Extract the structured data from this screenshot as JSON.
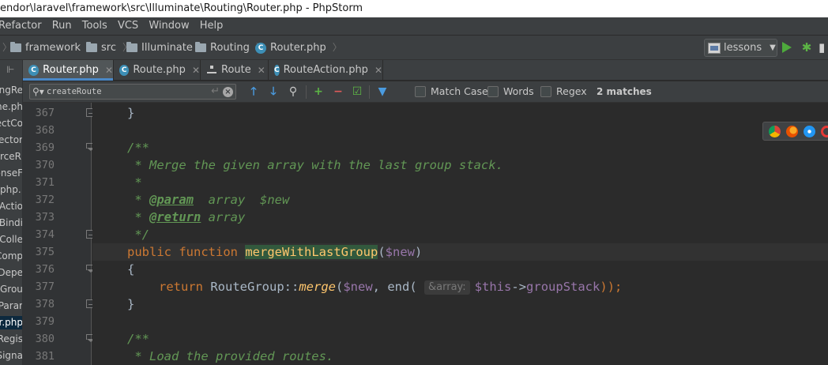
{
  "window": {
    "title": "endor\\laravel\\framework\\src\\Illuminate\\Routing\\Router.php - PhpStorm"
  },
  "menu": [
    "Refactor",
    "Run",
    "Tools",
    "VCS",
    "Window",
    "Help"
  ],
  "breadcrumbs": [
    "framework",
    "src",
    "Illuminate",
    "Routing",
    "Router.php"
  ],
  "run_config": {
    "label": "lessons"
  },
  "project_tree": [
    "ngRe",
    "ne.ph",
    "ectCo",
    "ector.",
    "rceR",
    "onseF",
    ".php",
    "Actio",
    "Bindi",
    "Colle",
    "Comp",
    "Depe",
    "Grou",
    "Parar",
    "r.php",
    "Regis",
    "Signa"
  ],
  "tabs": [
    {
      "label": "Router.php",
      "icon": "php-class-icon",
      "active": true
    },
    {
      "label": "Route.php",
      "icon": "php-class-icon",
      "active": false
    },
    {
      "label": "Route",
      "icon": "structure-icon",
      "active": false
    },
    {
      "label": "RouteAction.php",
      "icon": "php-class-icon",
      "active": false
    }
  ],
  "search": {
    "query": "createRoute",
    "match_case_label": "Match Case",
    "words_label": "Words",
    "regex_label": "Regex",
    "matches": "2 matches"
  },
  "editor": {
    "line_numbers": [
      "367",
      "368",
      "369",
      "370",
      "371",
      "372",
      "373",
      "374",
      "375",
      "376",
      "377",
      "378",
      "379",
      "380",
      "381"
    ],
    "code": {
      "l367": "}",
      "l369": "/**",
      "l370": " * Merge the given array with the last group stack.",
      "l371": " *",
      "l372_a": " * ",
      "l372_tag": "@param",
      "l372_b": "  array  $new",
      "l373_a": " * ",
      "l373_tag": "@return",
      "l373_b": " array",
      "l374": " */",
      "l375_kw1": "public",
      "l375_kw2": "function",
      "l375_fn": "mergeWithLastGroup",
      "l375_open": "(",
      "l375_var": "$new",
      "l375_close": ")",
      "l376": "{",
      "l377_kw": "return",
      "l377_cls": " RouteGroup::",
      "l377_sfn": "merge",
      "l377_p1": "(",
      "l377_var1": "$new",
      "l377_p2": ", end(",
      "l377_hint": "&array:",
      "l377_var2": "$this",
      "l377_arrow": "->",
      "l377_prop": "groupStack",
      "l377_end": "));",
      "l378": "}",
      "l380": "/**",
      "l381": " * Load the provided routes."
    }
  },
  "colors": {
    "accent": "#4a88c7",
    "keyword": "#cc7832",
    "function": "#ffc66d",
    "variable": "#9876aa",
    "comment": "#629755"
  }
}
